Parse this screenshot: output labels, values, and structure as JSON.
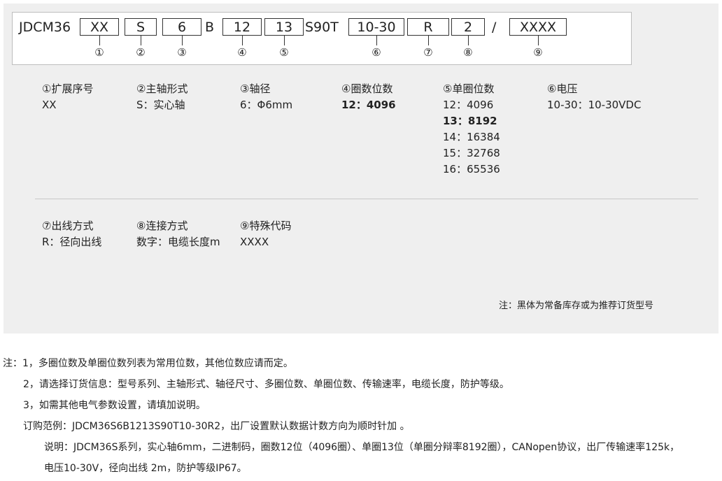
{
  "code": {
    "prefix": "JDCM36",
    "tokens": [
      {
        "type": "box",
        "text": "XX",
        "marker": "①"
      },
      {
        "type": "box",
        "text": "S",
        "marker": "②"
      },
      {
        "type": "box",
        "text": "6",
        "marker": "③"
      },
      {
        "type": "plain",
        "text": "B"
      },
      {
        "type": "box",
        "text": "12",
        "marker": "④"
      },
      {
        "type": "box",
        "text": "13",
        "marker": "⑤"
      },
      {
        "type": "plain",
        "text": "S90T"
      },
      {
        "type": "box",
        "text": "10-30",
        "marker": "⑥"
      },
      {
        "type": "box",
        "text": "R",
        "marker": "⑦"
      },
      {
        "type": "box",
        "text": "2",
        "marker": "⑧"
      },
      {
        "type": "plain",
        "text": "/"
      },
      {
        "type": "box",
        "text": "XXXX",
        "marker": "⑨"
      }
    ]
  },
  "specs_row1": [
    {
      "title": "①扩展序号",
      "values": [
        {
          "text": "XX",
          "bold": false
        }
      ]
    },
    {
      "title": "②主轴形式",
      "values": [
        {
          "text": "S：实心轴",
          "bold": false
        }
      ]
    },
    {
      "title": "③轴径",
      "values": [
        {
          "text": "6：Φ6mm",
          "bold": false
        }
      ]
    },
    {
      "title": "④圈数位数",
      "values": [
        {
          "text": "12：4096",
          "bold": true
        }
      ]
    },
    {
      "title": "⑤单圈位数",
      "values": [
        {
          "text": "12：4096",
          "bold": false
        },
        {
          "text": "13：8192",
          "bold": true
        },
        {
          "text": "14：16384",
          "bold": false
        },
        {
          "text": "15：32768",
          "bold": false
        },
        {
          "text": "16：65536",
          "bold": false
        }
      ]
    },
    {
      "title": "⑥电压",
      "values": [
        {
          "text": "10-30：10-30VDC",
          "bold": false
        }
      ]
    }
  ],
  "specs_row2": [
    {
      "title": "⑦出线方式",
      "values": [
        {
          "text": "R：径向出线",
          "bold": false
        }
      ]
    },
    {
      "title": "⑧连接方式",
      "values": [
        {
          "text": "数字：电缆长度m",
          "bold": false
        }
      ]
    },
    {
      "title": "⑨特殊代码",
      "values": [
        {
          "text": "XXXX",
          "bold": false
        }
      ]
    }
  ],
  "recommend_note": "注：黑体为常备库存或为推荐订货型号",
  "notes": [
    "注：1，多圈位数及单圈位数列表为常用位数，其他位数应请而定。",
    "2，请选择订货信息：型号系列、主轴形式、轴径尺寸、多圈位数、单圈位数、传输速率，电缆长度，防护等级。",
    "3，如需其他电气参数设置，请填加说明。",
    "订购范例：JDCM36S6B1213S90T10-30R2，出厂设置默认数据计数方向为顺时针加 。",
    "说明：JDCM36S系列，实心轴6mm，二进制码，圈数12位（4096圈）、单圈13位（单圈分辩率8192圈），CANopen协议，出厂传输速率125k，",
    "电压10-30V，径向出线 2m，防护等级IP67。"
  ]
}
